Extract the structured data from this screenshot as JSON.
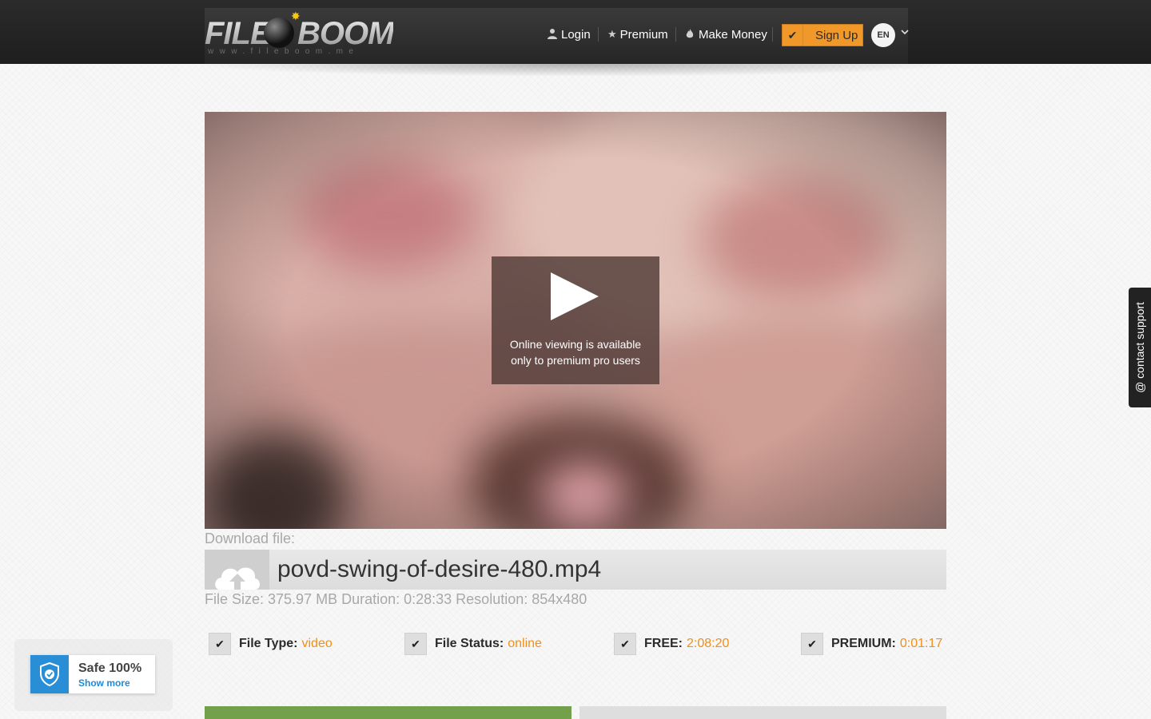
{
  "brand": {
    "logo_left": "FILE",
    "logo_right": "BOOM",
    "logo_sub": "www.fileboom.me"
  },
  "nav": {
    "login": "Login",
    "premium": "Premium",
    "make_money": "Make Money",
    "signup": "Sign Up",
    "language": "EN"
  },
  "player": {
    "message_line1": "Online viewing is available",
    "message_line2": "only to premium pro users"
  },
  "file": {
    "download_label": "Download file:",
    "name": "povd-swing-of-desire-480.mp4",
    "meta": "File Size: 375.97 MB Duration: 0:28:33 Resolution: 854x480"
  },
  "stats": [
    {
      "key": "File Type:",
      "value": "video"
    },
    {
      "key": "File Status:",
      "value": "online"
    },
    {
      "key": "FREE:",
      "value": "2:08:20"
    },
    {
      "key": "PREMIUM:",
      "value": "0:01:17"
    }
  ],
  "safe_badge": {
    "title": "Safe 100%",
    "link": "Show more"
  },
  "support": {
    "label": "@ contact support"
  },
  "colors": {
    "accent_orange": "#f0982a",
    "value_orange": "#ef8f1c",
    "header_dark": "#222222",
    "download_green": "#73a04b",
    "safe_blue": "#2a8ed6"
  },
  "icons": {
    "login": "user-icon",
    "premium": "star-icon",
    "make_money": "fire-icon",
    "signup": "check-icon",
    "upload": "cloud-upload-icon"
  }
}
